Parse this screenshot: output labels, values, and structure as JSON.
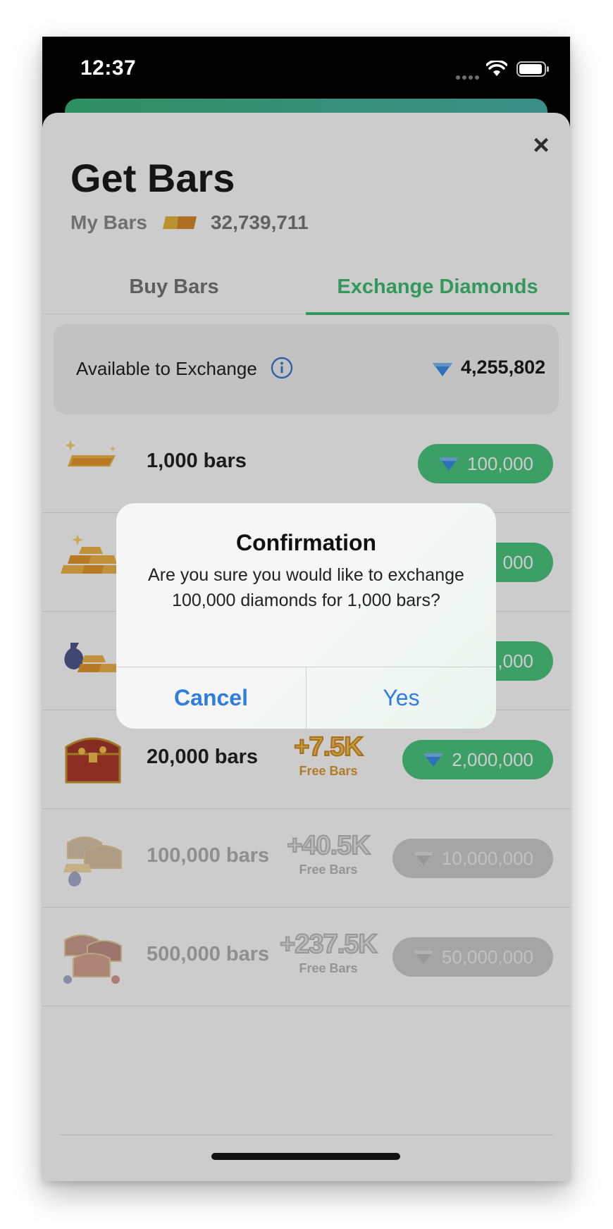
{
  "status_bar": {
    "time": "12:37"
  },
  "sheet": {
    "title": "Get Bars",
    "my_bars_label": "My Bars",
    "my_bars_count": "32,739,711",
    "tabs": [
      {
        "label": "Buy Bars",
        "active": false
      },
      {
        "label": "Exchange Diamonds",
        "active": true
      }
    ],
    "available_label": "Available to Exchange",
    "available_value": "4,255,802",
    "rows": [
      {
        "label": "1,000 bars",
        "bonus": "",
        "bonus_sub": "",
        "price": "100,000",
        "enabled": true,
        "thumb": "sparkle-gold-bar-icon"
      },
      {
        "label": "",
        "bonus": "",
        "bonus_sub": "",
        "price": "000",
        "enabled": true,
        "thumb": "gold-bar-pile-icon"
      },
      {
        "label": "",
        "bonus": "",
        "bonus_sub": "",
        "price": ",000",
        "enabled": true,
        "thumb": "money-bag-gold-bars-icon"
      },
      {
        "label": "20,000 bars",
        "bonus": "+7.5K",
        "bonus_sub": "Free Bars",
        "price": "2,000,000",
        "enabled": true,
        "thumb": "treasure-chest-icon"
      },
      {
        "label": "100,000 bars",
        "bonus": "+40.5K",
        "bonus_sub": "Free Bars",
        "price": "10,000,000",
        "enabled": false,
        "thumb": "treasure-pile-icon"
      },
      {
        "label": "500,000 bars",
        "bonus": "+237.5K",
        "bonus_sub": "Free Bars",
        "price": "50,000,000",
        "enabled": false,
        "thumb": "treasure-chests-icon"
      }
    ]
  },
  "dialog": {
    "title": "Confirmation",
    "message": "Are you sure you would like to exchange 100,000 diamonds for 1,000 bars?",
    "cancel_label": "Cancel",
    "confirm_label": "Yes"
  },
  "colors": {
    "accent_green": "#4cc77f",
    "tab_green": "#3fbf73",
    "link_blue": "#2f7de1",
    "diamond_blue": "#3d8fe8"
  }
}
